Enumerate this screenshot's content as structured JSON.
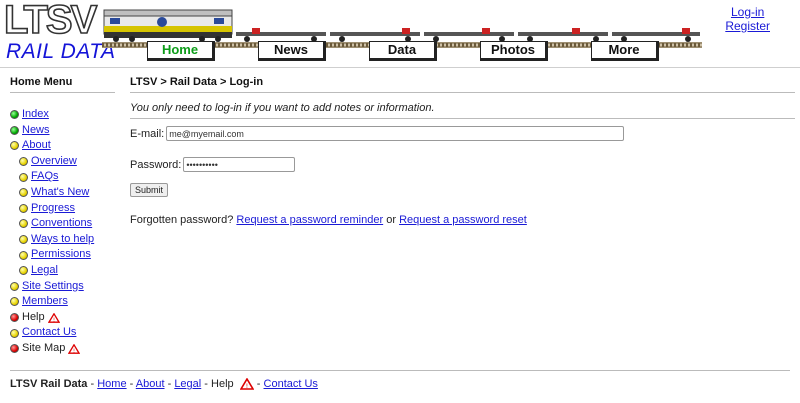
{
  "header": {
    "logo_top": "LTSV",
    "logo_bottom": "RAIL DATA",
    "nav": [
      {
        "label": "Home",
        "active": true
      },
      {
        "label": "News",
        "active": false
      },
      {
        "label": "Data",
        "active": false
      },
      {
        "label": "Photos",
        "active": false
      },
      {
        "label": "More",
        "active": false
      }
    ],
    "login_link": "Log-in",
    "register_link": "Register"
  },
  "sidebar": {
    "title": "Home Menu",
    "items": [
      {
        "label": "Index",
        "dot": "green",
        "link": true,
        "sub": false,
        "warn": false
      },
      {
        "label": "News",
        "dot": "green",
        "link": true,
        "sub": false,
        "warn": false
      },
      {
        "label": "About",
        "dot": "yellow",
        "link": true,
        "sub": false,
        "warn": false
      },
      {
        "label": "Overview",
        "dot": "yellow",
        "link": true,
        "sub": true,
        "warn": false
      },
      {
        "label": "FAQs",
        "dot": "yellow",
        "link": true,
        "sub": true,
        "warn": false
      },
      {
        "label": "What's New",
        "dot": "yellow",
        "link": true,
        "sub": true,
        "warn": false
      },
      {
        "label": "Progress",
        "dot": "yellow",
        "link": true,
        "sub": true,
        "warn": false
      },
      {
        "label": "Conventions",
        "dot": "yellow",
        "link": true,
        "sub": true,
        "warn": false
      },
      {
        "label": "Ways to help",
        "dot": "yellow",
        "link": true,
        "sub": true,
        "warn": false
      },
      {
        "label": "Permissions",
        "dot": "yellow",
        "link": true,
        "sub": true,
        "warn": false
      },
      {
        "label": "Legal",
        "dot": "yellow",
        "link": true,
        "sub": true,
        "warn": false
      },
      {
        "label": "Site Settings",
        "dot": "yellow",
        "link": true,
        "sub": false,
        "warn": false
      },
      {
        "label": "Members",
        "dot": "yellow",
        "link": true,
        "sub": false,
        "warn": false
      },
      {
        "label": "Help",
        "dot": "red",
        "link": false,
        "sub": false,
        "warn": true
      },
      {
        "label": "Contact Us",
        "dot": "yellow",
        "link": true,
        "sub": false,
        "warn": false
      },
      {
        "label": "Site Map",
        "dot": "red",
        "link": false,
        "sub": false,
        "warn": true
      }
    ]
  },
  "main": {
    "breadcrumb": "LTSV > Rail Data > Log-in",
    "intro": "You only need to log-in if you want to add notes or information.",
    "email_label": "E-mail:",
    "email_value": "me@myemail.com",
    "password_label": "Password:",
    "password_value": "••••••••••",
    "submit_label": "Submit",
    "forgot_text": "Forgotten password?",
    "reminder_link": "Request a password reminder",
    "or_text": "or",
    "reset_link": "Request a password reset"
  },
  "footer": {
    "site_name": "LTSV Rail Data",
    "sep": "-",
    "home_link": "Home",
    "about_link": "About",
    "legal_link": "Legal",
    "help_text": "Help",
    "contact_link": "Contact Us"
  },
  "colors": {
    "link": "#1a1ad6",
    "active_tab": "#0c9c18",
    "logo_blue": "#1414d8"
  }
}
